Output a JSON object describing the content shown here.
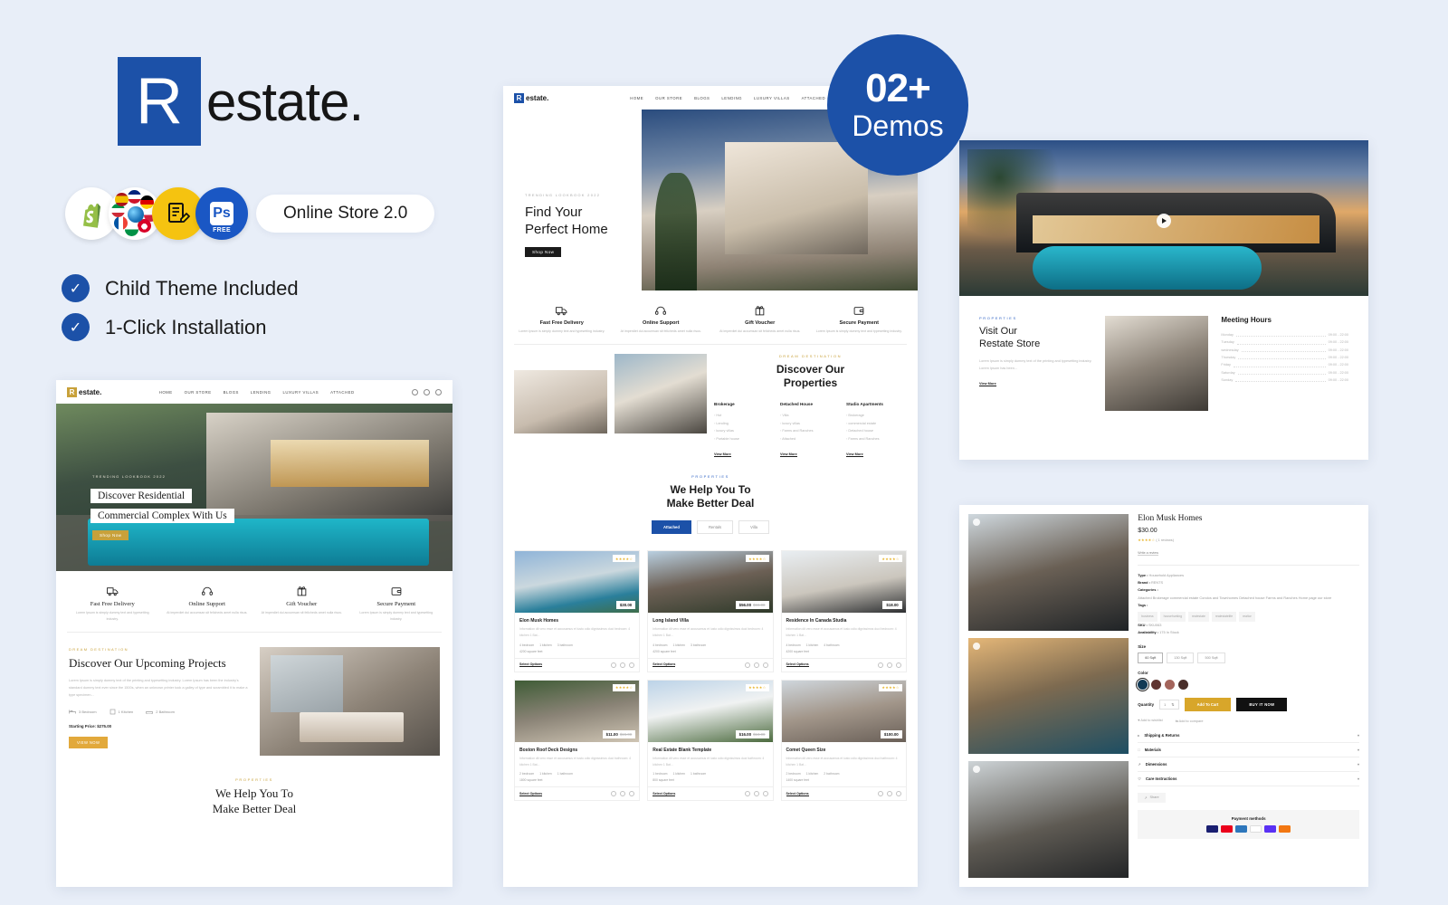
{
  "brand": {
    "logo_letter": "R",
    "logo_word": "estate.",
    "accent_blue": "#1c51a8",
    "accent_gold": "#c8a13a"
  },
  "promo": {
    "pill_label": "Online Store 2.0",
    "badges": [
      {
        "name": "shopify-badge",
        "label": "Shopify"
      },
      {
        "name": "multilanguage-badge",
        "label": "Multi Language"
      },
      {
        "name": "rtl-ready-badge",
        "label": "RTL Ready"
      },
      {
        "name": "photoshop-free-badge",
        "label": "Ps",
        "sub": "FREE"
      }
    ],
    "features": [
      {
        "icon": "check-icon",
        "label": "Child Theme Included"
      },
      {
        "icon": "check-icon",
        "label": "1-Click Installation"
      }
    ]
  },
  "demos_badge": {
    "count": "02+",
    "label": "Demos"
  },
  "nav": {
    "items": [
      "HOME",
      "OUR STORE",
      "BLOGS",
      "LENDING",
      "LUXURY VILLAS",
      "ATTACHED"
    ],
    "icons": [
      "search-icon",
      "account-icon",
      "cart-icon"
    ]
  },
  "left_demo": {
    "hero": {
      "eyebrow": "TRENDING LOOKBOOK 2022",
      "line1": "Discover Residential",
      "line2": "Commercial Complex With Us",
      "button": "Shop Now"
    },
    "features": [
      {
        "icon": "truck-icon",
        "title": "Fast Free Delivery",
        "desc": "Lorem Ipsum is simply dummy text and typesetting industry."
      },
      {
        "icon": "headset-icon",
        "title": "Online Support",
        "desc": "At imperdiet dui accumsan sit felicheds amet nulla risus."
      },
      {
        "icon": "gift-icon",
        "title": "Gift Voucher",
        "desc": "At imperdiet dui accumsan sit felicheds amet nulla risus."
      },
      {
        "icon": "wallet-icon",
        "title": "Secure Payment",
        "desc": "Lorem Ipsum is simply dummy text and typesetting industry."
      }
    ],
    "projects": {
      "eyebrow": "DREAM DESTINATION",
      "heading": "Discover Our Upcoming Projects",
      "body": "Lorem Ipsum is simply dummy text of the printing and typesetting industry. Lorem Ipsum has been the industry's standard dummy text ever since the 1500s, when an unknown printer took a galley of type and scrambled it to make a type specimen...",
      "specs": [
        "3 Bedroom",
        "1 Kitchen",
        "2 Bathroom"
      ],
      "price": "Starting Price: $275.00",
      "button": "VIEW NOW"
    },
    "deal": {
      "eyebrow": "PROPERTIES",
      "line1": "We Help You To",
      "line2": "Make Better Deal"
    }
  },
  "center_demo": {
    "hero": {
      "eyebrow": "TRENDING LOOKBOOK 2022",
      "line1": "Find Your",
      "line2": "Perfect Home",
      "button": "Shop Now"
    },
    "features": [
      {
        "icon": "truck-icon",
        "title": "Fast Free Delivery",
        "desc": "Lorem Ipsum is simply dummy text and typesetting industry."
      },
      {
        "icon": "headset-icon",
        "title": "Online Support",
        "desc": "At imperdiet dui accumsan sit felicheds amet nulla risus."
      },
      {
        "icon": "gift-icon",
        "title": "Gift Voucher",
        "desc": "At imperdiet dui accumsan sit felicheds amet nulla risus."
      },
      {
        "icon": "wallet-icon",
        "title": "Secure Payment",
        "desc": "Lorem Ipsum is simply dummy text and typesetting industry."
      }
    ],
    "discover": {
      "eyebrow": "DREAM DESTINATION",
      "line1": "Discover Our",
      "line2": "Properties",
      "columns": [
        {
          "title": "Brokerage",
          "items": [
            "Hut",
            "Lending",
            "luxury villas",
            "Portable house"
          ],
          "link": "View More"
        },
        {
          "title": "Detached House",
          "items": [
            "Villa",
            "luxury villas",
            "Farms and Ranches",
            "Attached"
          ],
          "link": "View More"
        },
        {
          "title": "Studio Apartments",
          "items": [
            "Brokerage",
            "commercial estate",
            "Detached house",
            "Farms and Ranches"
          ],
          "link": "View More"
        }
      ]
    },
    "deal": {
      "eyebrow": "PROPERTIES",
      "line1": "We Help You To",
      "line2": "Make Better Deal",
      "tabs": [
        "Attached",
        "Rentals",
        "Villa"
      ],
      "active_tab": "Attached",
      "cards": [
        {
          "name": "Elon Musk Homes",
          "price": "$30.00",
          "compare": "",
          "stars": "★★★★☆",
          "desc": "Information dit vero esse et accusamus et iusto odio dignissimos duci bedroom: 4 kitchen 1 Bat...",
          "bed": "4 bedroom",
          "kitchen": "1 kitchen",
          "bath": "3 bathroom",
          "sqft": "4200 square feet",
          "action": "Select Options"
        },
        {
          "name": "Long Island Villa",
          "price": "$56.00",
          "compare": "$66.00",
          "stars": "★★★★☆",
          "desc": "Information dit vero esse et accusamus et iusto odio dignissimos duci bedroom: 4 kitchen 1 Bat...",
          "bed": "4 bedroom",
          "kitchen": "1 kitchen",
          "bath": "3 bathroom",
          "sqft": "4200 square feet",
          "action": "Select Options"
        },
        {
          "name": "Residence In Canada Studia",
          "price": "$18.00",
          "compare": "",
          "stars": "★★★★☆",
          "desc": "Information dit vero esse et accusamus et iusto odio dignissimos duci bedroom: 4 kitchen 1 Bat...",
          "bed": "4 bedroom",
          "kitchen": "1 kitchen",
          "bath": "4 bathroom",
          "sqft": "4200 square feet",
          "action": "Select Options"
        },
        {
          "name": "Boston Roof Deck Designs",
          "price": "$11.00",
          "compare": "$15.00",
          "stars": "★★★★☆",
          "desc": "Information dit vero esse et accusamus et iusto odio dignissimos duci bathroom: 4 kitchen 1 Bat...",
          "bed": "2 bedroom",
          "kitchen": "1 kitchen",
          "bath": "1 bathroom",
          "sqft": "1800 square feet",
          "action": "Select Options"
        },
        {
          "name": "Real Estate Blank Template",
          "price": "$16.00",
          "compare": "$18.00",
          "stars": "★★★★☆",
          "desc": "Information dit vero esse et accusamus et iusto odio dignissimos duci bathroom: 4 kitchen 1 Bat...",
          "bed": "1 bedroom",
          "kitchen": "1 kitchen",
          "bath": "1 bathroom",
          "sqft": "800 square feet",
          "action": "Select Options"
        },
        {
          "name": "Comet Queen Size",
          "price": "$100.00",
          "compare": "",
          "stars": "★★★★☆",
          "desc": "Information dit vero esse et accusamus et iusto odio dignissimos duci bathroom: 4 kitchen 1 Bat...",
          "bed": "2 bedroom",
          "kitchen": "1 kitchen",
          "bath": "2 bathroom",
          "sqft": "1400 square feet",
          "action": "Select Options"
        }
      ]
    }
  },
  "store_demo": {
    "play_icon": "play-icon",
    "eyebrow": "PROPERTIES",
    "line1": "Visit Our",
    "line2": "Restate Store",
    "body": "Lorem Ipsum is simply dummy text of the printing and typesetting industry. Lorem Ipsum has been...",
    "link": "View More",
    "hours_title": "Meeting Hours",
    "hours": [
      {
        "day": "Monday",
        "time": "09:00 - 22:00"
      },
      {
        "day": "Tuesday",
        "time": "09:00 - 22:00"
      },
      {
        "day": "wednesday",
        "time": "09:00 - 22:00"
      },
      {
        "day": "Thursday",
        "time": "09:00 - 22:00"
      },
      {
        "day": "Friday",
        "time": "09:00 - 22:00"
      },
      {
        "day": "Saturday",
        "time": "09:00 - 22:00"
      },
      {
        "day": "Sunday",
        "time": "09:00 - 22:00"
      }
    ]
  },
  "product_demo": {
    "title": "Elon Musk Homes",
    "price": "$30.00",
    "stars": "★★★★☆",
    "reviews": "( 1 reviews)",
    "write_review": "Write a review",
    "type_label": "Type :",
    "type_value": "Household Appliances",
    "brand_label": "Brand :",
    "brand_value": "RENTS",
    "categories_label": "Categories :",
    "categories_value": "Attached  Brokerage  commercial estate  Condos and Townhomes  Detached house  Farms and Ranches  Home page  our store",
    "tags_label": "Tags :",
    "tags": [
      "business",
      "househunting",
      "realestate",
      "realestatelife",
      "realtor"
    ],
    "sku_label": "SKU :",
    "sku_value": "SKU063",
    "availability_label": "Availability :",
    "availability_value": "175 In Stock",
    "size_label": "Size",
    "sizes": [
      "60 Sqft",
      "130 Sqft",
      "500 Sqft"
    ],
    "active_size": "60 Sqft",
    "color_label": "Color",
    "colors": [
      "#123a55",
      "#5f3430",
      "#a4655c",
      "#4a2f2b"
    ],
    "quantity_label": "Quantity",
    "quantity_value": "1",
    "add_to_cart": "Add To Cart",
    "buy_now": "BUY IT NOW",
    "wishlist": "Add to wishlist",
    "compare": "Add to compare",
    "accordions": [
      {
        "icon": "truck-icon",
        "label": "Shipping & Returns"
      },
      {
        "icon": "box-icon",
        "label": "Materials"
      },
      {
        "icon": "ruler-icon",
        "label": "Dimensions"
      },
      {
        "icon": "heart-icon",
        "label": "Care Instructions"
      }
    ],
    "share": "Share",
    "payment_title": "Payment methods",
    "payment_methods": [
      "visa",
      "mastercard",
      "amex",
      "paypal",
      "shop-pay",
      "discover"
    ]
  }
}
